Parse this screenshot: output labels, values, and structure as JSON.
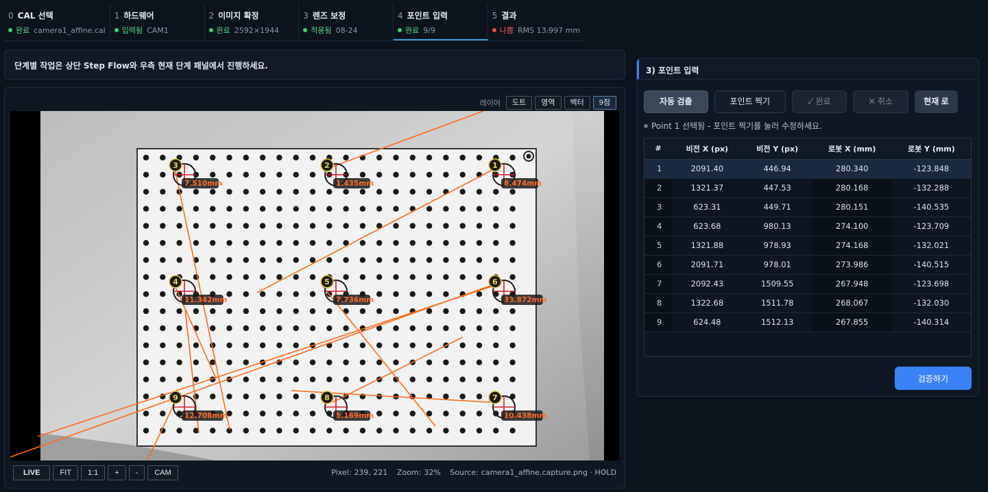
{
  "steps": [
    {
      "num": "0",
      "title": "CAL 선택",
      "state": "완료",
      "state_color": "green",
      "detail": "camera1_affine.cal"
    },
    {
      "num": "1",
      "title": "하드웨어",
      "state": "입력됨",
      "state_color": "green",
      "detail": "CAM1"
    },
    {
      "num": "2",
      "title": "이미지 확정",
      "state": "완료",
      "state_color": "green",
      "detail": "2592×1944"
    },
    {
      "num": "3",
      "title": "렌즈 보정",
      "state": "적용됨",
      "state_color": "green",
      "detail": "08-24"
    },
    {
      "num": "4",
      "title": "포인트 입력",
      "state": "완료",
      "state_color": "green",
      "detail": "9/9",
      "active": true
    },
    {
      "num": "5",
      "title": "결과",
      "state": "나쁨",
      "state_color": "red",
      "detail": "RMS 13.997 mm"
    }
  ],
  "notice": "단계별 작업은 상단 Step Flow와 우측 현재 단계 패널에서 진행하세요.",
  "viewer": {
    "layer_label": "레이어",
    "layer_buttons": [
      "도트",
      "영역",
      "벡터",
      "9점"
    ],
    "points": [
      {
        "id": "1",
        "label": "8.474mm"
      },
      {
        "id": "2",
        "label": "1.435mm"
      },
      {
        "id": "3",
        "label": "7.510mm"
      },
      {
        "id": "4",
        "label": "11.342mm"
      },
      {
        "id": "5",
        "label": "7.736mm"
      },
      {
        "id": "6",
        "label": "33.872mm"
      },
      {
        "id": "7",
        "label": "10.438mm"
      },
      {
        "id": "8",
        "label": "5.169mm"
      },
      {
        "id": "9",
        "label": "12.708mm"
      }
    ],
    "buttons": {
      "live": "LIVE",
      "fit": "FIT",
      "one": "1:1",
      "plus": "+",
      "minus": "-",
      "cam": "CAM"
    },
    "status": {
      "pixel_label": "Pixel:",
      "pixel": "239, 221",
      "zoom_label": "Zoom:",
      "zoom": "32%",
      "source_label": "Source:",
      "source": "camera1_affine.capture.png · HOLD"
    }
  },
  "panel": {
    "title": "3) 포인트 입력",
    "actions": {
      "auto": "자동 검출",
      "pick": "포인트 찍기",
      "done": "✓ 완료",
      "cancel": "✕ 취소",
      "current": "현재 로"
    },
    "selection": "Point 1 선택됨 - 포인트 찍기를 눌러 수정하세요.",
    "columns": [
      "#",
      "비전 X (px)",
      "비전 Y (px)",
      "로봇 X (mm)",
      "로봇 Y (mm)"
    ],
    "rows": [
      [
        "1",
        "2091.40",
        "446.94",
        "280.340",
        "-123.848"
      ],
      [
        "2",
        "1321.37",
        "447.53",
        "280.168",
        "-132.288"
      ],
      [
        "3",
        "623.31",
        "449.71",
        "280.151",
        "-140.535"
      ],
      [
        "4",
        "623.68",
        "980.13",
        "274.100",
        "-123.709"
      ],
      [
        "5",
        "1321.88",
        "978.93",
        "274.168",
        "-132.021"
      ],
      [
        "6",
        "2091.71",
        "978.01",
        "273.986",
        "-140.515"
      ],
      [
        "7",
        "2092.43",
        "1509.55",
        "267.948",
        "-123.698"
      ],
      [
        "8",
        "1322.68",
        "1511.78",
        "268.067",
        "-132.030"
      ],
      [
        "9",
        "624.48",
        "1512.13",
        "267.855",
        "-140.314"
      ]
    ],
    "verify": "검증하기"
  },
  "colors": {
    "accent": "#3b82f6",
    "vector": "#ff6a1a",
    "ok": "#3ecf6e",
    "bad": "#ef4b4b"
  }
}
